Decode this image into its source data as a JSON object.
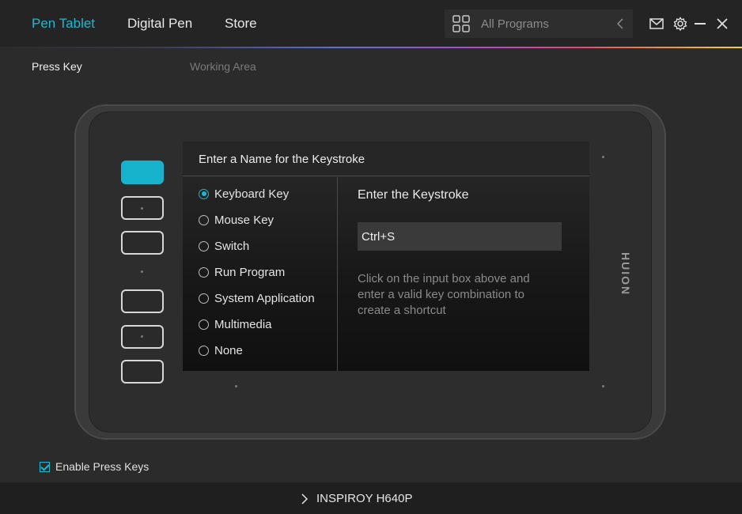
{
  "nav": {
    "tabs": [
      {
        "label": "Pen Tablet",
        "active": true
      },
      {
        "label": "Digital Pen",
        "active": false
      },
      {
        "label": "Store",
        "active": false
      }
    ],
    "program_select": {
      "value": "All Programs",
      "icon": "grid-icon"
    },
    "window_icons": [
      "mail-icon",
      "gear-icon",
      "minimize-icon",
      "close-icon"
    ],
    "accent_color": "#22b7cf"
  },
  "subtabs": [
    {
      "label": "Press Key",
      "active": true
    },
    {
      "label": "Working Area",
      "active": false
    }
  ],
  "tablet": {
    "brand": "HUION",
    "express_keys": [
      {
        "id": 1,
        "active": true
      },
      {
        "id": 2,
        "active": false
      },
      {
        "id": 3,
        "active": false
      },
      {
        "id": 4,
        "active": false
      },
      {
        "id": 5,
        "active": false
      },
      {
        "id": 6,
        "active": false
      }
    ]
  },
  "dialog": {
    "title": "Enter a Name for the Keystroke",
    "options": [
      {
        "label": "Keyboard Key",
        "checked": true
      },
      {
        "label": "Mouse Key",
        "checked": false
      },
      {
        "label": "Switch",
        "checked": false
      },
      {
        "label": "Run Program",
        "checked": false
      },
      {
        "label": "System Application",
        "checked": false
      },
      {
        "label": "Multimedia",
        "checked": false
      },
      {
        "label": "None",
        "checked": false
      }
    ],
    "keystroke_title": "Enter the Keystroke",
    "keystroke_value": "Ctrl+S",
    "hint": "Click on the input box above and enter a valid key combination to create a shortcut"
  },
  "enable_press_keys": {
    "label": "Enable Press Keys",
    "checked": true
  },
  "footer": {
    "device": "INSPIROY H640P"
  }
}
